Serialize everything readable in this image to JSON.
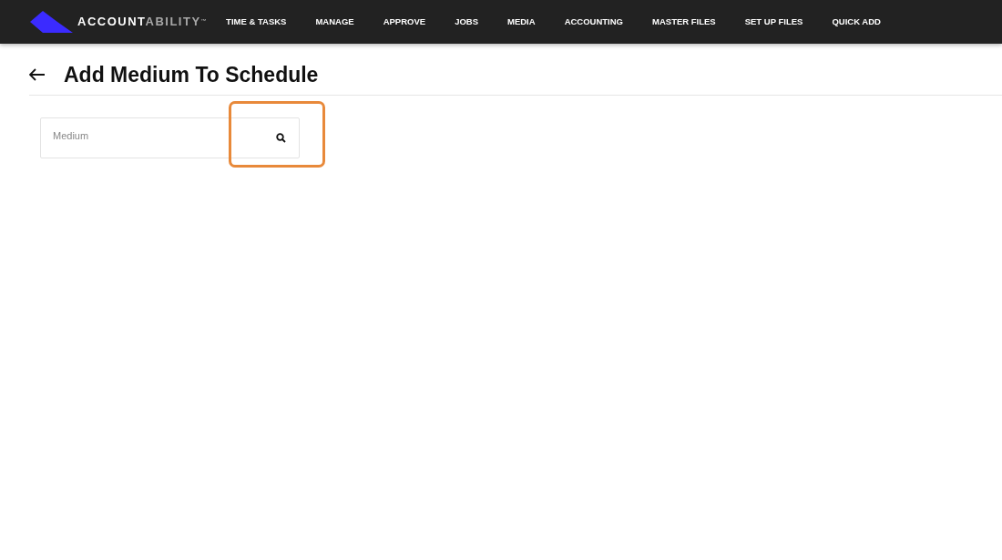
{
  "brand": {
    "primary": "ACCOUNT",
    "secondary": "ABILITY",
    "mark": "™"
  },
  "nav": [
    "TIME & TASKS",
    "MANAGE",
    "APPROVE",
    "JOBS",
    "MEDIA",
    "ACCOUNTING",
    "MASTER FILES",
    "SET UP FILES",
    "QUICK ADD"
  ],
  "page": {
    "title": "Add Medium To Schedule"
  },
  "search": {
    "placeholder": "Medium",
    "highlighted": true
  }
}
